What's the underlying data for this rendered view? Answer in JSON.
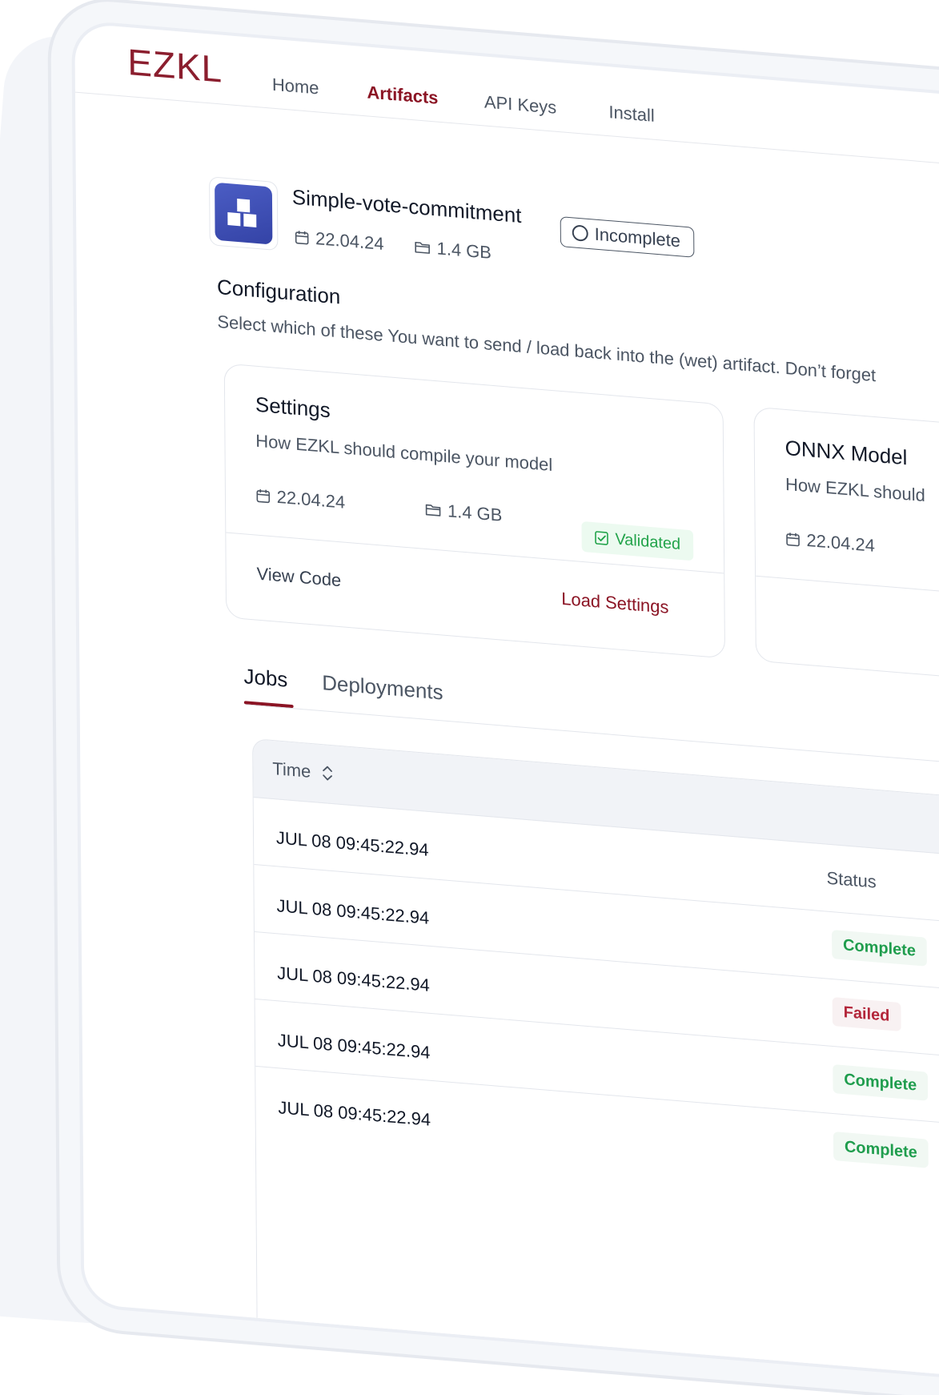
{
  "app": {
    "logo_text": "EZKL",
    "nav": [
      {
        "label": "Home",
        "active": false
      },
      {
        "label": "Artifacts",
        "active": true
      },
      {
        "label": "API Keys",
        "active": false
      },
      {
        "label": "Install",
        "active": false
      }
    ],
    "accent_color": "#8b1424"
  },
  "artifact": {
    "name": "Simple-vote-commitment",
    "status_badge": "Incomplete",
    "date": "22.04.24",
    "size": "1.4 GB",
    "icon": "boxes-icon"
  },
  "configuration": {
    "title": "Configuration",
    "subtitle": "Select which of these You want to send / load back into the (wet) artifact. Don’t forget"
  },
  "cards": [
    {
      "title": "Settings",
      "description": "How EZKL should compile your model",
      "date": "22.04.24",
      "size": "1.4 GB",
      "badge": "Validated",
      "secondary_action": "View Code",
      "primary_action": "Load Settings"
    },
    {
      "title": "ONNX Model",
      "description": "How EZKL should",
      "date": "22.04.24"
    }
  ],
  "tabs": [
    {
      "label": "Jobs",
      "active": true
    },
    {
      "label": "Deployments",
      "active": false
    }
  ],
  "table": {
    "columns": {
      "time": "Time",
      "status": "Status"
    },
    "rows": [
      {
        "time": "JUL 08 09:45:22.94",
        "status": ""
      },
      {
        "time": "JUL 08 09:45:22.94",
        "status": "Complete"
      },
      {
        "time": "JUL 08 09:45:22.94",
        "status": "Failed"
      },
      {
        "time": "JUL 08 09:45:22.94",
        "status": "Complete"
      },
      {
        "time": "JUL 08 09:45:22.94",
        "status": "Complete"
      }
    ]
  },
  "colors": {
    "success": "#1f9d4d",
    "danger": "#b3263a",
    "primary_icon": "#3f4fb6"
  }
}
